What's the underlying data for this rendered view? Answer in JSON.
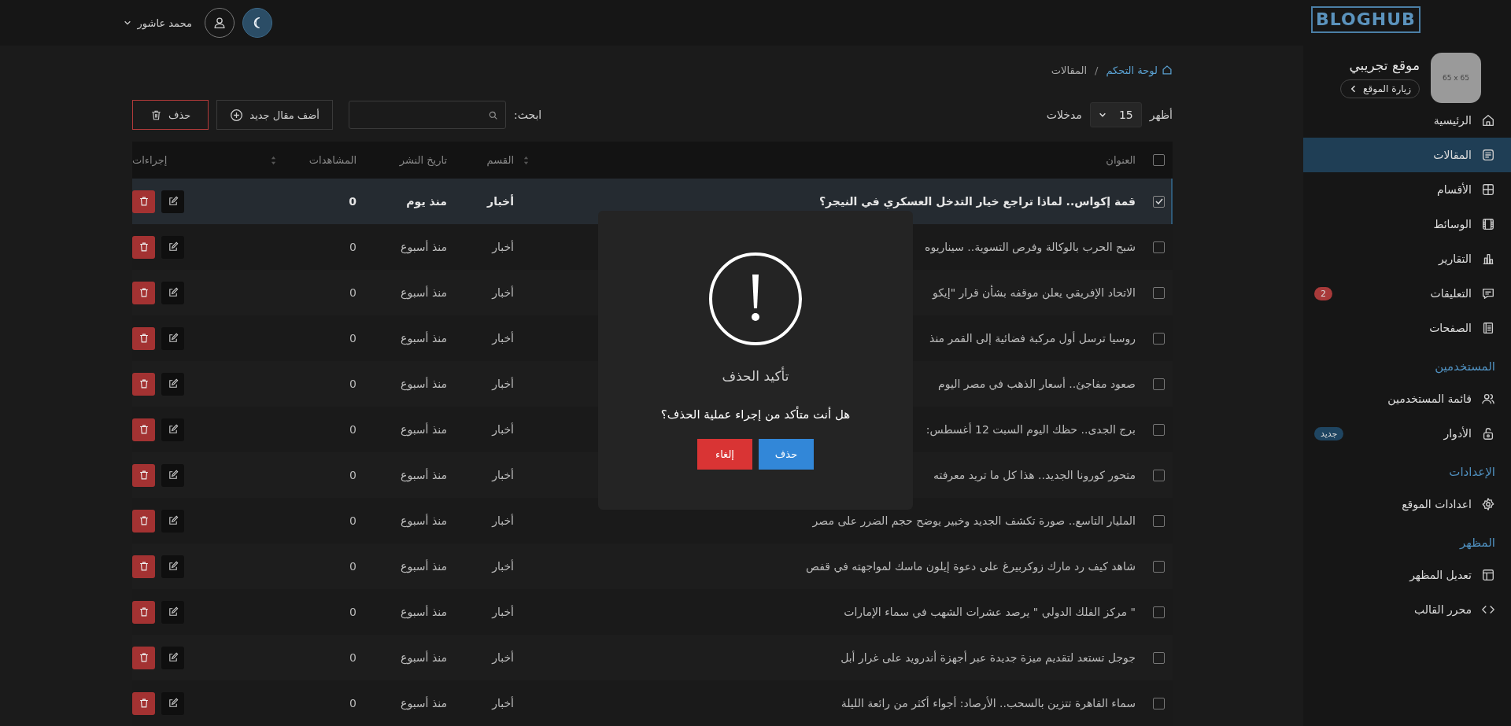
{
  "topbar": {
    "user_name": "محمد عاشور"
  },
  "sidebar": {
    "logo": "BLOGHUB",
    "site": {
      "avatar_text": "65 x 65",
      "name": "موقع تجريبي",
      "visit_button": "زيارة الموقع"
    },
    "groups": [
      {
        "items": [
          {
            "label": "الرئيسية",
            "selected": false
          },
          {
            "label": "المقالات",
            "selected": true
          },
          {
            "label": "الأقسام",
            "selected": false
          },
          {
            "label": "الوسائط",
            "selected": false
          },
          {
            "label": "التقارير",
            "selected": false
          },
          {
            "label": "التعليقات",
            "selected": false,
            "badge": {
              "text": "2",
              "color": "#a83a3a"
            }
          },
          {
            "label": "الصفحات",
            "selected": false
          }
        ]
      },
      {
        "heading": "المستخدمين",
        "items": [
          {
            "label": "قائمة المستخدمين",
            "selected": false
          },
          {
            "label": "الأدوار",
            "selected": false,
            "badge": {
              "text": "جديد",
              "color": "#1f4561"
            }
          }
        ]
      },
      {
        "heading": "الإعدادات",
        "items": [
          {
            "label": "اعدادات الموقع",
            "selected": false
          }
        ]
      },
      {
        "heading": "المظهر",
        "items": [
          {
            "label": "تعديل المظهر",
            "selected": false
          },
          {
            "label": "محرر القالب",
            "selected": false
          }
        ]
      }
    ]
  },
  "breadcrumb": {
    "separator": "/",
    "items": [
      {
        "label": "لوحة التحكم",
        "kind": "link"
      },
      {
        "label": "المقالات",
        "kind": "current"
      }
    ]
  },
  "toolbar": {
    "show_label": "أظهر",
    "page_size": "15",
    "entries_label": "مدخلات",
    "search_label": "ابحث:",
    "add_button": "أضف مقال جديد",
    "delete_button": "حذف"
  },
  "table": {
    "all_checked": false,
    "columns": [
      {
        "label": "العنوان",
        "sortable": true
      },
      {
        "label": "القسم",
        "sortable": false
      },
      {
        "label": "تاريخ النشر",
        "sortable": false
      },
      {
        "label": "المشاهدات",
        "sortable": true
      },
      {
        "label": "إجراءات",
        "sortable": false
      }
    ],
    "rows": [
      {
        "checked": true,
        "title": "قمة إكواس.. لماذا تراجع خيار التدخل العسكري في النيجر؟",
        "section": "أخبار",
        "date": "منذ يوم",
        "views": "0"
      },
      {
        "checked": false,
        "title": "شبح الحرب بالوكالة وفرص التسوية.. سيناريوه",
        "section": "أخبار",
        "date": "منذ أسبوع",
        "views": "0"
      },
      {
        "checked": false,
        "title": "الاتحاد الإفريقي يعلن موقفه بشأن قرار \"إيكو",
        "section": "أخبار",
        "date": "منذ أسبوع",
        "views": "0"
      },
      {
        "checked": false,
        "title": "روسيا ترسل أول مركبة فضائية إلى القمر منذ",
        "section": "أخبار",
        "date": "منذ أسبوع",
        "views": "0"
      },
      {
        "checked": false,
        "title": "صعود مفاجئ.. أسعار الذهب في مصر اليوم",
        "section": "أخبار",
        "date": "منذ أسبوع",
        "views": "0"
      },
      {
        "checked": false,
        "title": "برج الجدى.. حظك اليوم السبت 12 أغسطس:",
        "section": "أخبار",
        "date": "منذ أسبوع",
        "views": "0"
      },
      {
        "checked": false,
        "title": "متحور كورونا الجديد.. هذا كل ما تريد معرفته",
        "section": "أخبار",
        "date": "منذ أسبوع",
        "views": "0"
      },
      {
        "checked": false,
        "title": "المليار التاسع.. صورة تكشف الجديد وخبير يوضح حجم الضرر على مصر",
        "section": "أخبار",
        "date": "منذ أسبوع",
        "views": "0"
      },
      {
        "checked": false,
        "title": "شاهد كيف رد مارك زوكربيرغ على دعوة إيلون ماسك لمواجهته في قفص",
        "section": "أخبار",
        "date": "منذ أسبوع",
        "views": "0"
      },
      {
        "checked": false,
        "title": "\" مركز الفلك الدولي \" يرصد عشرات الشهب في سماء الإمارات",
        "section": "أخبار",
        "date": "منذ أسبوع",
        "views": "0"
      },
      {
        "checked": false,
        "title": "جوجل تستعد لتقديم ميزة جديدة عبر أجهزة أندرويد على غرار أبل",
        "section": "أخبار",
        "date": "منذ أسبوع",
        "views": "0"
      },
      {
        "checked": false,
        "title": "سماء القاهرة تتزين بالسحب.. الأرصاد: أجواء أكثر من رائعة الليلة",
        "section": "أخبار",
        "date": "منذ أسبوع",
        "views": "0"
      }
    ]
  },
  "dialog": {
    "title": "تأكيد الحذف",
    "message": "هل أنت متأكد من إجراء عملية الحذف؟",
    "confirm_button": "حذف",
    "cancel_button": "إلغاء"
  }
}
